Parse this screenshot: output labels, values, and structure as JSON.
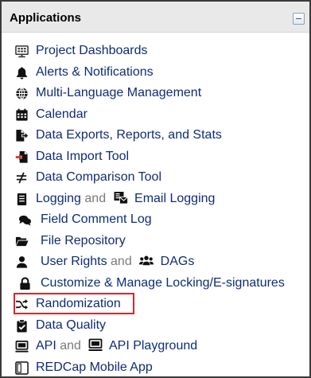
{
  "panel": {
    "title": "Applications",
    "collapse_icon": "minus-box-icon"
  },
  "items": [
    {
      "label": "Project Dashboards",
      "icon": "dashboard-icon"
    },
    {
      "label": "Alerts & Notifications",
      "icon": "bell-icon"
    },
    {
      "label": "Multi-Language Management",
      "icon": "globe-icon"
    },
    {
      "label": "Calendar",
      "icon": "calendar-icon"
    },
    {
      "label": "Data Exports, Reports, and Stats",
      "icon": "file-export-icon"
    },
    {
      "label": "Data Import Tool",
      "icon": "file-import-icon"
    },
    {
      "label": "Data Comparison Tool",
      "icon": "not-equal-icon"
    },
    {
      "label": "Logging",
      "joiner": "and",
      "label2": "Email Logging",
      "icon": "logging-icon",
      "icon2": "email-logging-icon"
    },
    {
      "label": "Field Comment Log",
      "icon": "comments-icon"
    },
    {
      "label": "File Repository",
      "icon": "folder-icon"
    },
    {
      "label": "User Rights",
      "joiner": "and",
      "label2": "DAGs",
      "icon": "user-icon",
      "icon2": "users-group-icon"
    },
    {
      "label": "Customize & Manage Locking/E-signatures",
      "icon": "lock-icon"
    },
    {
      "label": "Randomization",
      "icon": "random-icon",
      "highlighted": true
    },
    {
      "label": "Data Quality",
      "icon": "clipboard-check-icon"
    },
    {
      "label": "API",
      "joiner": "and",
      "label2": "API Playground",
      "icon": "api-icon",
      "icon2": "api-playground-icon"
    },
    {
      "label": "REDCap Mobile App",
      "icon": "tablet-icon"
    }
  ],
  "colors": {
    "link": "#0e2c76",
    "muted": "#7a7a7a",
    "header_bg": "#e9e9e9",
    "highlight": "#d9262c"
  }
}
